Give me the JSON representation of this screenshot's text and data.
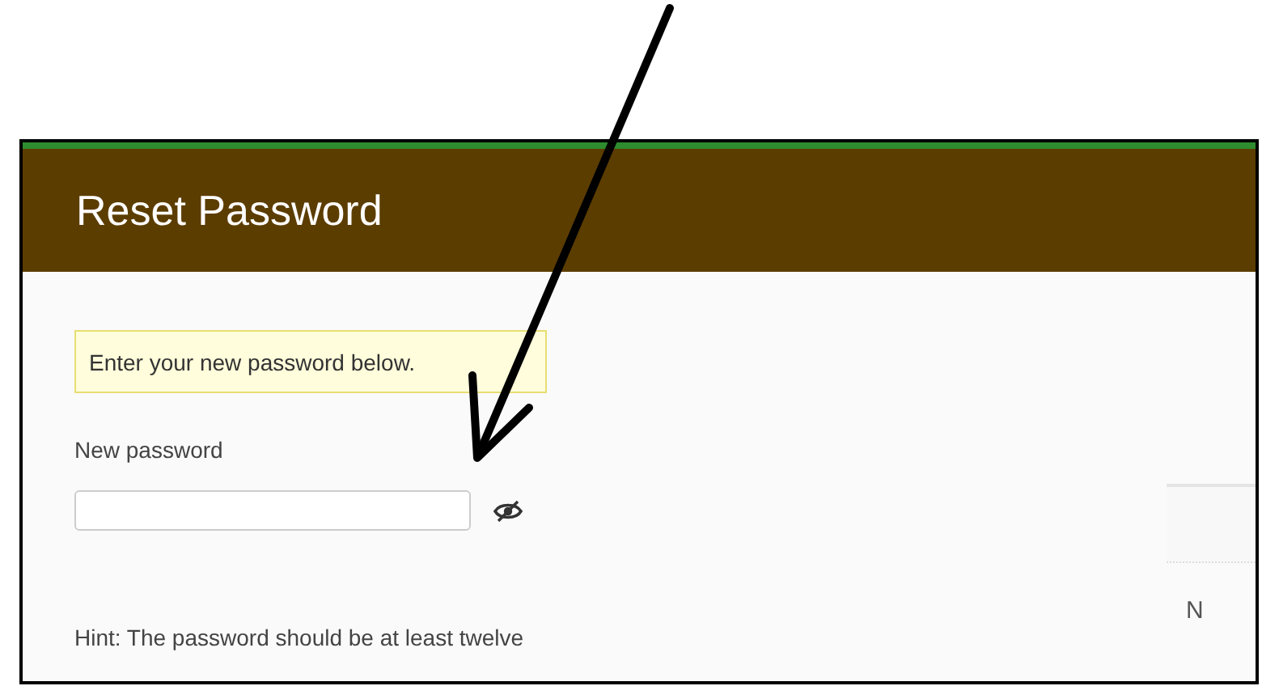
{
  "header": {
    "title": "Reset Password"
  },
  "notice": "Enter your new password below.",
  "password_field": {
    "label": "New password",
    "password_visible": false
  },
  "hint": "Hint: The password should be at least twelve",
  "side_panel": {
    "label": "N"
  }
}
